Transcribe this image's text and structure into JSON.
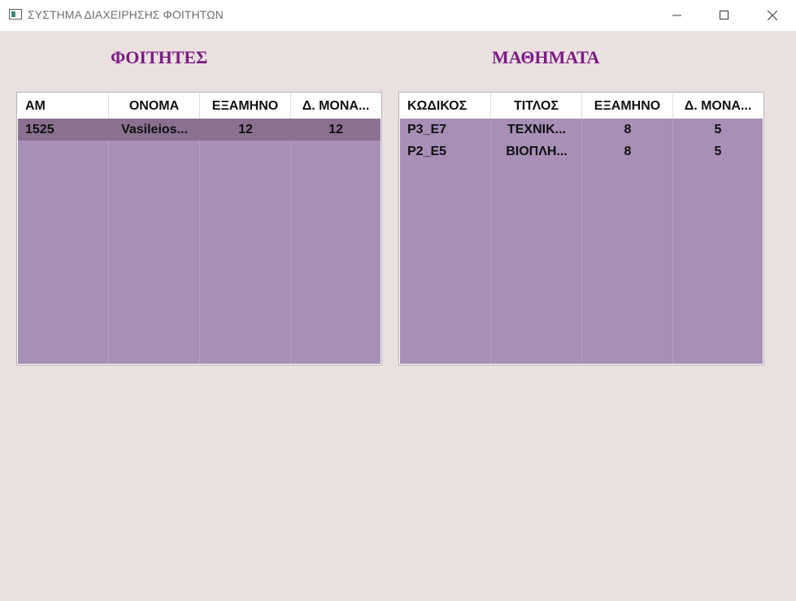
{
  "window": {
    "title": "ΣΥΣΤΗΜΑ ΔΙΑΧΕΙΡΗΣΗΣ ΦΟΙΤΗΤΩΝ"
  },
  "colors": {
    "background": "#ebe0e0",
    "title_accent": "#7a1d82",
    "table_fill": "#a78fb5",
    "selected_row": "#8b7190"
  },
  "students": {
    "title": "ΦΟΙΤΗΤΕΣ",
    "headers": [
      "ΑΜ",
      "ΟΝΟΜΑ",
      "ΕΞΑΜΗΝΟ",
      "Δ. ΜΟΝΑ..."
    ],
    "rows": [
      [
        "1525",
        "Vasileios...",
        "12",
        "12"
      ]
    ],
    "selected_row": 0
  },
  "courses": {
    "title": "ΜΑΘΗΜΑΤΑ",
    "headers": [
      "ΚΩΔΙΚΟΣ",
      "ΤΙΤΛΟΣ",
      "ΕΞΑΜΗΝΟ",
      "Δ. ΜΟΝΑ..."
    ],
    "rows": [
      [
        "P3_E7",
        "ΤΕΧΝΙΚ...",
        "8",
        "5"
      ],
      [
        "P2_E5",
        "ΒΙΟΠΛΗ...",
        "8",
        "5"
      ]
    ]
  }
}
